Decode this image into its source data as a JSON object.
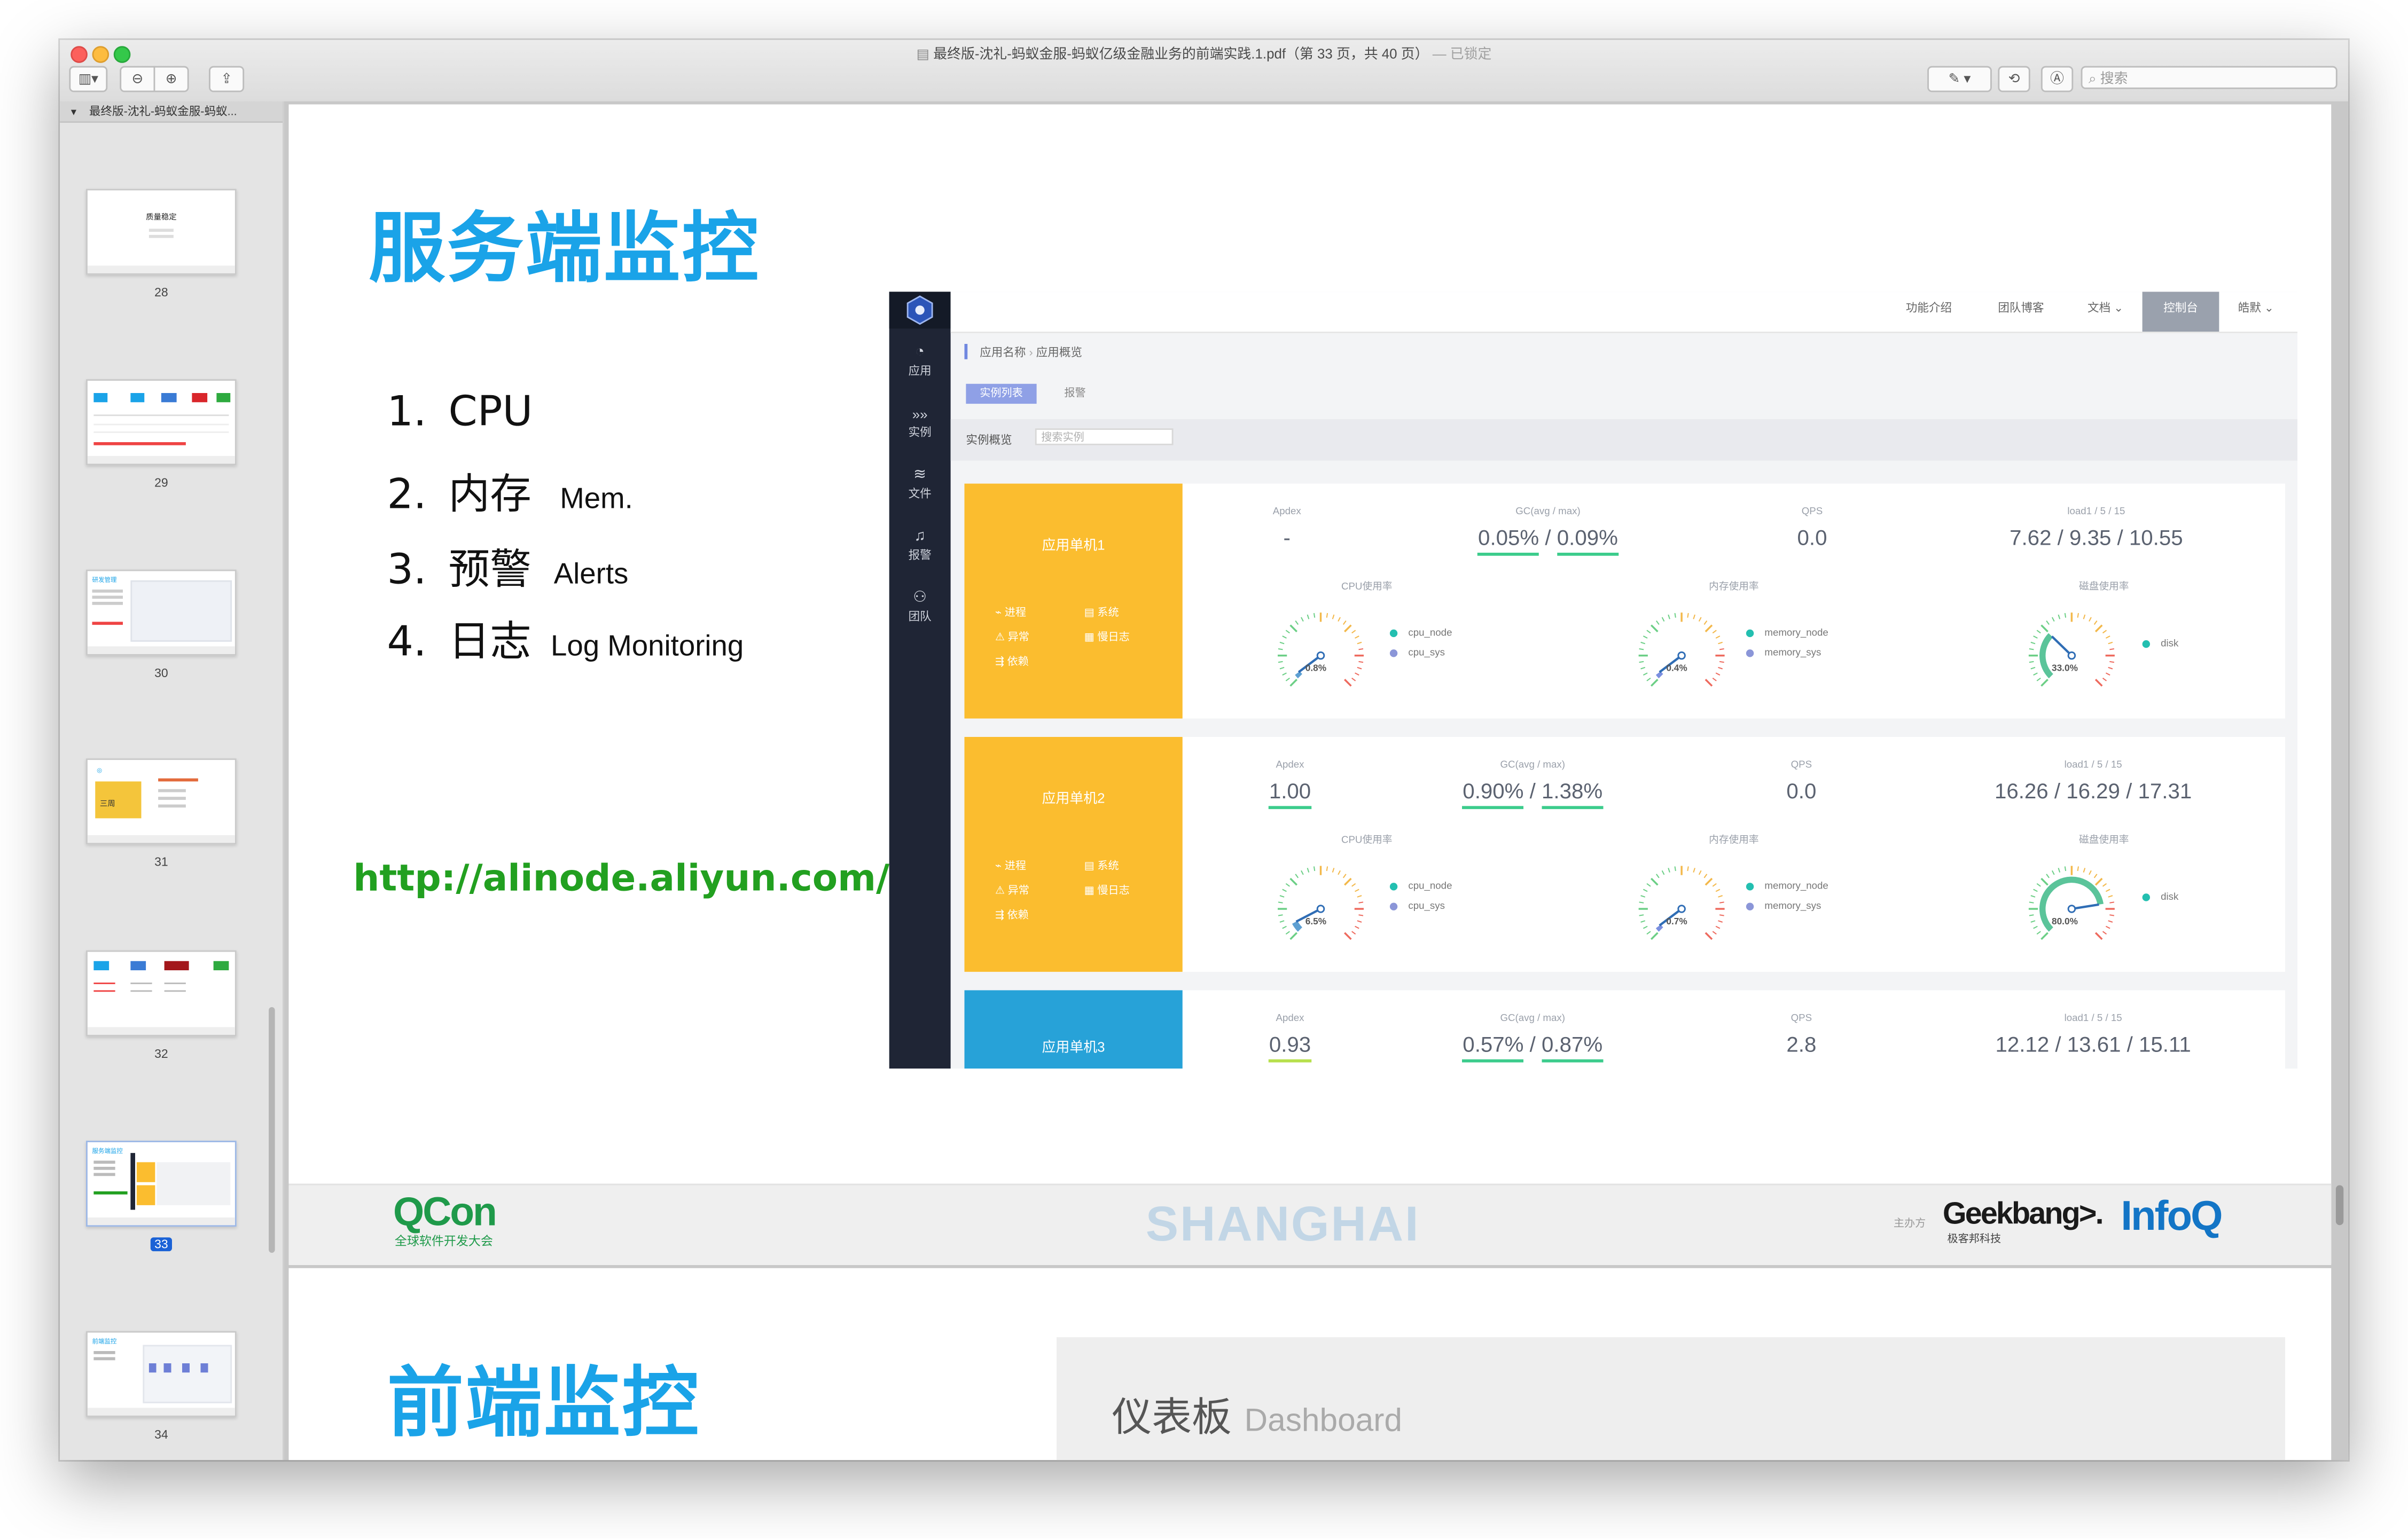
{
  "window": {
    "title": "最终版-沈礼-蚂蚁金服-蚂蚁亿级金融业务的前端实践.1.pdf（第 33 页，共 40 页）",
    "title_suffix": "— 已锁定",
    "search_placeholder": "搜索",
    "colors": {
      "close": "#fc605c",
      "minimize": "#fdbc40",
      "zoom": "#34c84a"
    }
  },
  "sidebar": {
    "document_name": "最终版-沈礼-蚂蚁金服-蚂蚁...",
    "pages": [
      {
        "number": "28",
        "thumb_title": "质量稳定",
        "selected": false
      },
      {
        "number": "29",
        "thumb_title": "",
        "selected": false
      },
      {
        "number": "30",
        "thumb_title": "研发管理",
        "selected": false
      },
      {
        "number": "31",
        "thumb_title": "三周",
        "selected": false
      },
      {
        "number": "32",
        "thumb_title": "",
        "selected": false
      },
      {
        "number": "33",
        "thumb_title": "服务端监控",
        "selected": true
      },
      {
        "number": "34",
        "thumb_title": "前端监控",
        "selected": false
      }
    ]
  },
  "slide": {
    "title": "服务端监控",
    "list": [
      {
        "num": "1.",
        "cn": "CPU",
        "en": ""
      },
      {
        "num": "2.",
        "cn": "内存",
        "en": "Mem."
      },
      {
        "num": "3.",
        "cn": "预警",
        "en": "Alerts"
      },
      {
        "num": "4.",
        "cn": "日志",
        "en": "Log Monitoring"
      }
    ],
    "url": "http://alinode.aliyun.com/",
    "accent_color": "#1aa3e8",
    "url_color": "#22a020"
  },
  "dashboard": {
    "nav": [
      "应用",
      "实例",
      "文件",
      "报警",
      "团队"
    ],
    "top_menu": [
      "功能介绍",
      "团队博客",
      "文档",
      "控制台",
      "皓默"
    ],
    "breadcrumb": [
      "应用名称",
      "应用概览"
    ],
    "tabs": [
      "实例列表",
      "报警"
    ],
    "section_label": "实例概览",
    "search_placeholder": "搜索实例",
    "metric_labels": {
      "apdex": "Apdex",
      "gc": "GC(avg / max)",
      "qps": "QPS",
      "load": "load1 / 5 / 15",
      "cpu": "CPU使用率",
      "mem": "内存使用率",
      "disk": "磁盘使用率"
    },
    "links": {
      "process": "进程",
      "system": "系统",
      "exception": "异常",
      "slowlog": "慢日志",
      "deps": "依赖"
    },
    "legends": {
      "cpu_node": "cpu_node",
      "cpu_sys": "cpu_sys",
      "mem_node": "memory_node",
      "mem_sys": "memory_sys",
      "disk": "disk"
    },
    "instances": [
      {
        "name": "应用单机1",
        "color": "#fbbd2f",
        "apdex": "-",
        "gc_avg": "0.05%",
        "gc_max": "0.09%",
        "qps": "0.0",
        "load": "7.62 / 9.35 / 10.55",
        "cpu": "0.8%",
        "cpu_value": 0.8,
        "mem": "0.4%",
        "mem_value": 0.4,
        "disk": "33.0%",
        "disk_value": 33.0
      },
      {
        "name": "应用单机2",
        "color": "#fbbd2f",
        "apdex": "1.00",
        "gc_avg": "0.90%",
        "gc_max": "1.38%",
        "qps": "0.0",
        "load": "16.26 / 16.29 / 17.31",
        "cpu": "6.5%",
        "cpu_value": 6.5,
        "mem": "0.7%",
        "mem_value": 0.7,
        "disk": "80.0%",
        "disk_value": 80.0
      },
      {
        "name": "应用单机3",
        "color": "#27a2d8",
        "apdex": "0.93",
        "gc_avg": "0.57%",
        "gc_max": "0.87%",
        "qps": "2.8",
        "load": "12.12 / 13.61 / 15.11"
      }
    ]
  },
  "footer": {
    "qcon_logo": "QCon",
    "qcon_sub": "全球软件开发大会",
    "city": "SHANGHAI",
    "organizer_label": "主办方",
    "geekbang_logo": "Geekbang>.",
    "geekbang_sub": "极客邦科技",
    "infoq_logo": "InfoQ"
  },
  "next_slide": {
    "title": "前端监控",
    "panel_cn": "仪表板",
    "panel_en": "Dashboard"
  }
}
